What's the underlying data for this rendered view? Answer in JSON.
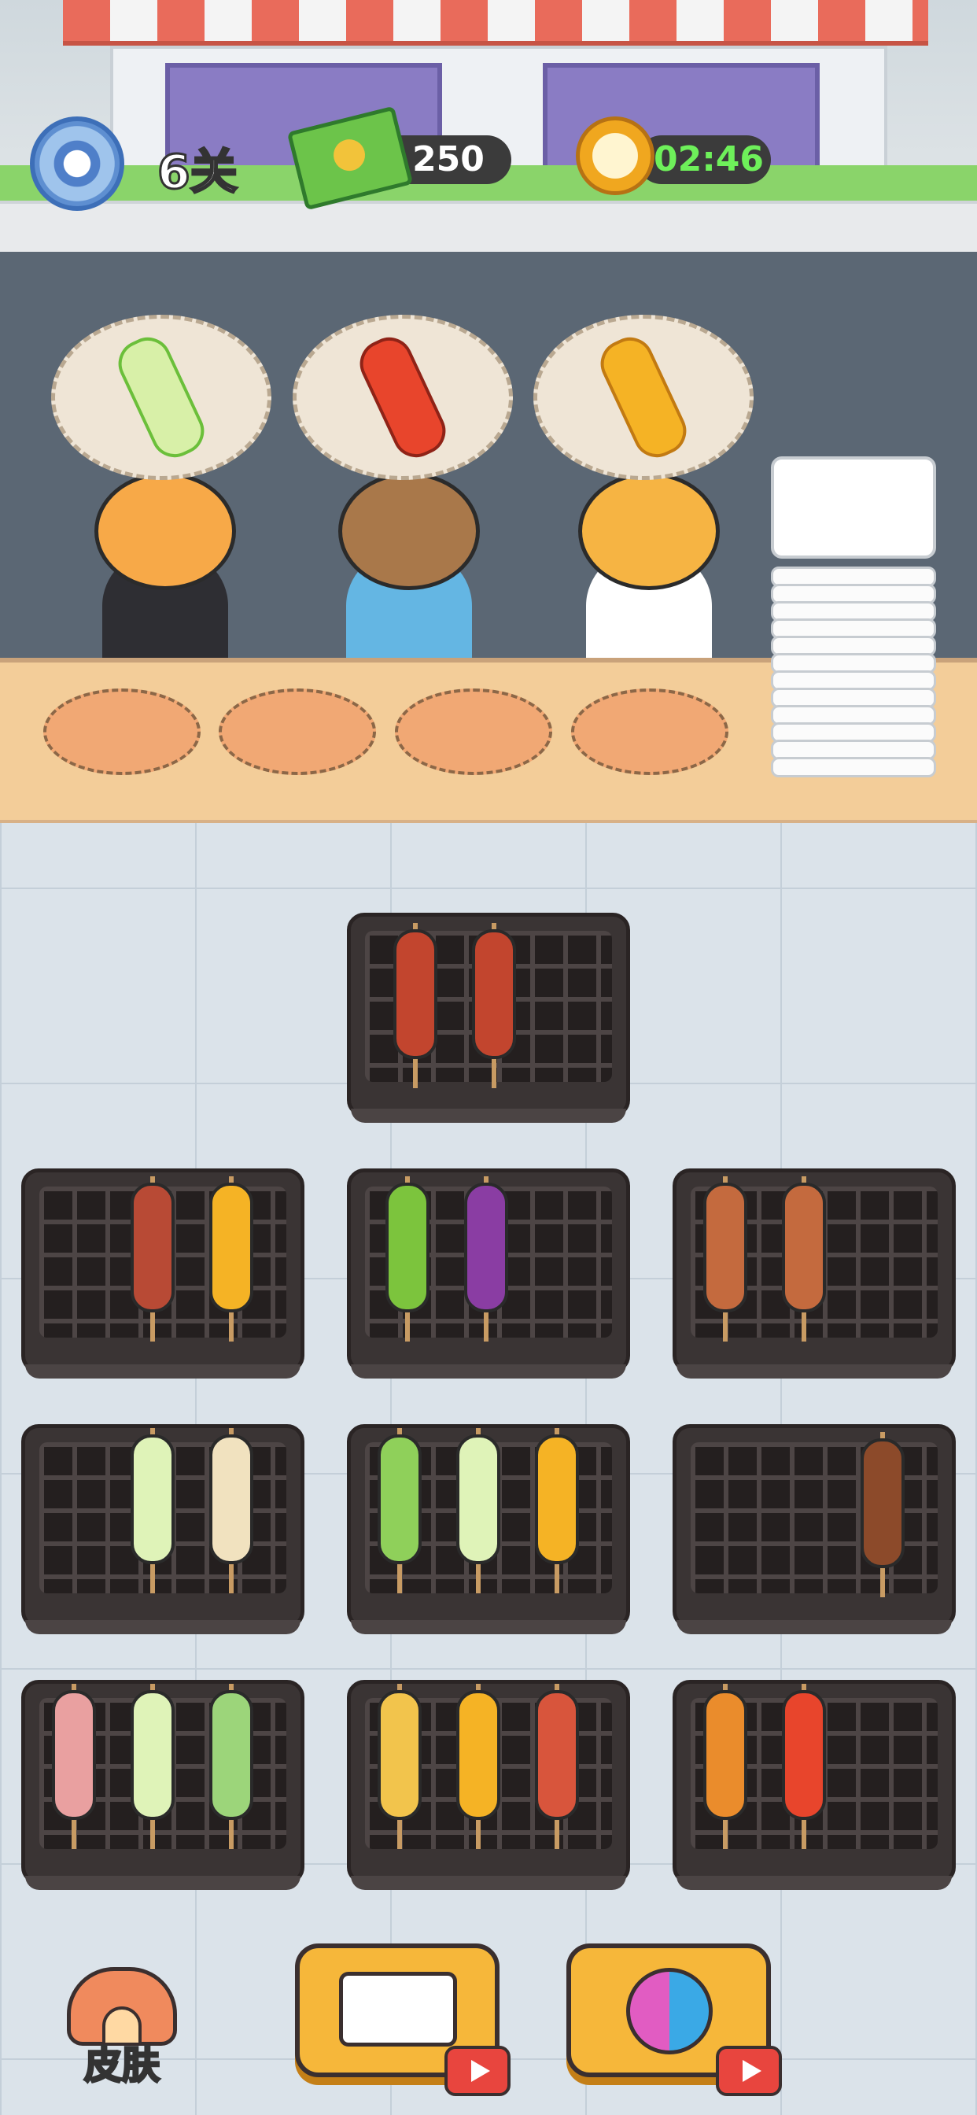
{
  "hud": {
    "level": "6关",
    "cash": "250",
    "timer": "02:46"
  },
  "icons": {
    "settings": "gear-icon",
    "cash": "banknote-icon",
    "timer": "stopwatch-icon",
    "skin": "house-hammer-icon",
    "takeout": "takeout-box-icon",
    "shuffle": "refresh-icon",
    "ad": "video-ad-icon"
  },
  "customers": [
    {
      "name": "cat",
      "order": "napa-cabbage"
    },
    {
      "name": "bear",
      "order": "crayfish"
    },
    {
      "name": "shiba",
      "order": "corn"
    }
  ],
  "bottom": {
    "skin_label": "皮肤"
  },
  "colors": {
    "button": "#f6b73a",
    "counter": "#f3cd99",
    "slot": "#f1a874",
    "timer_text": "#6ef05a"
  }
}
